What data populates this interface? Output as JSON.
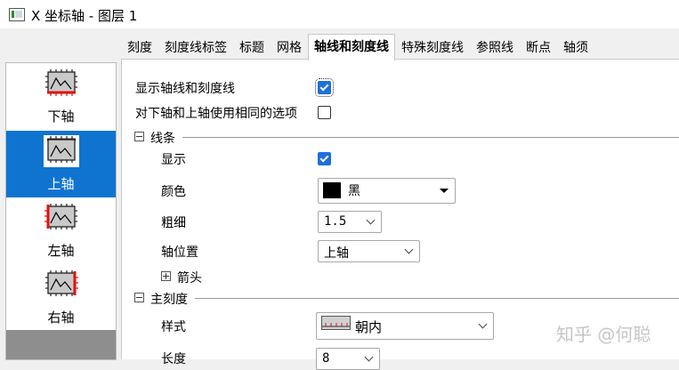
{
  "window": {
    "title": "X 坐标轴 - 图层 1"
  },
  "tabs": [
    {
      "label": "刻度",
      "active": false
    },
    {
      "label": "刻度线标签",
      "active": false
    },
    {
      "label": "标题",
      "active": false
    },
    {
      "label": "网格",
      "active": false
    },
    {
      "label": "轴线和刻度线",
      "active": true
    },
    {
      "label": "特殊刻度线",
      "active": false
    },
    {
      "label": "参照线",
      "active": false
    },
    {
      "label": "断点",
      "active": false
    },
    {
      "label": "轴须",
      "active": false
    }
  ],
  "sidebar": {
    "items": [
      {
        "label": "下轴",
        "selected": false,
        "icon": "bottom-axis-icon"
      },
      {
        "label": "上轴",
        "selected": true,
        "icon": "top-axis-icon"
      },
      {
        "label": "左轴",
        "selected": false,
        "icon": "left-axis-icon"
      },
      {
        "label": "右轴",
        "selected": false,
        "icon": "right-axis-icon"
      }
    ]
  },
  "panel": {
    "show_axis_ticks": {
      "label": "显示轴线和刻度线",
      "checked": true
    },
    "same_options": {
      "label": "对下轴和上轴使用相同的选项",
      "checked": false
    },
    "line_section": {
      "title": "线条",
      "show": {
        "label": "显示",
        "checked": true
      },
      "color": {
        "label": "颜色",
        "value": "黑",
        "swatch": "#000000"
      },
      "thickness": {
        "label": "粗细",
        "value": "1.5"
      },
      "axis_position": {
        "label": "轴位置",
        "value": "上轴"
      },
      "arrow": {
        "label": "箭头"
      }
    },
    "major_tick_section": {
      "title": "主刻度",
      "style": {
        "label": "样式",
        "value": "朝内"
      },
      "length": {
        "label": "长度",
        "value": "8"
      }
    }
  },
  "watermark": "知乎 @何聪",
  "colors": {
    "selection": "#0f74d0",
    "checkbox": "#1e6fd9",
    "axis_highlight": "#e01010"
  }
}
